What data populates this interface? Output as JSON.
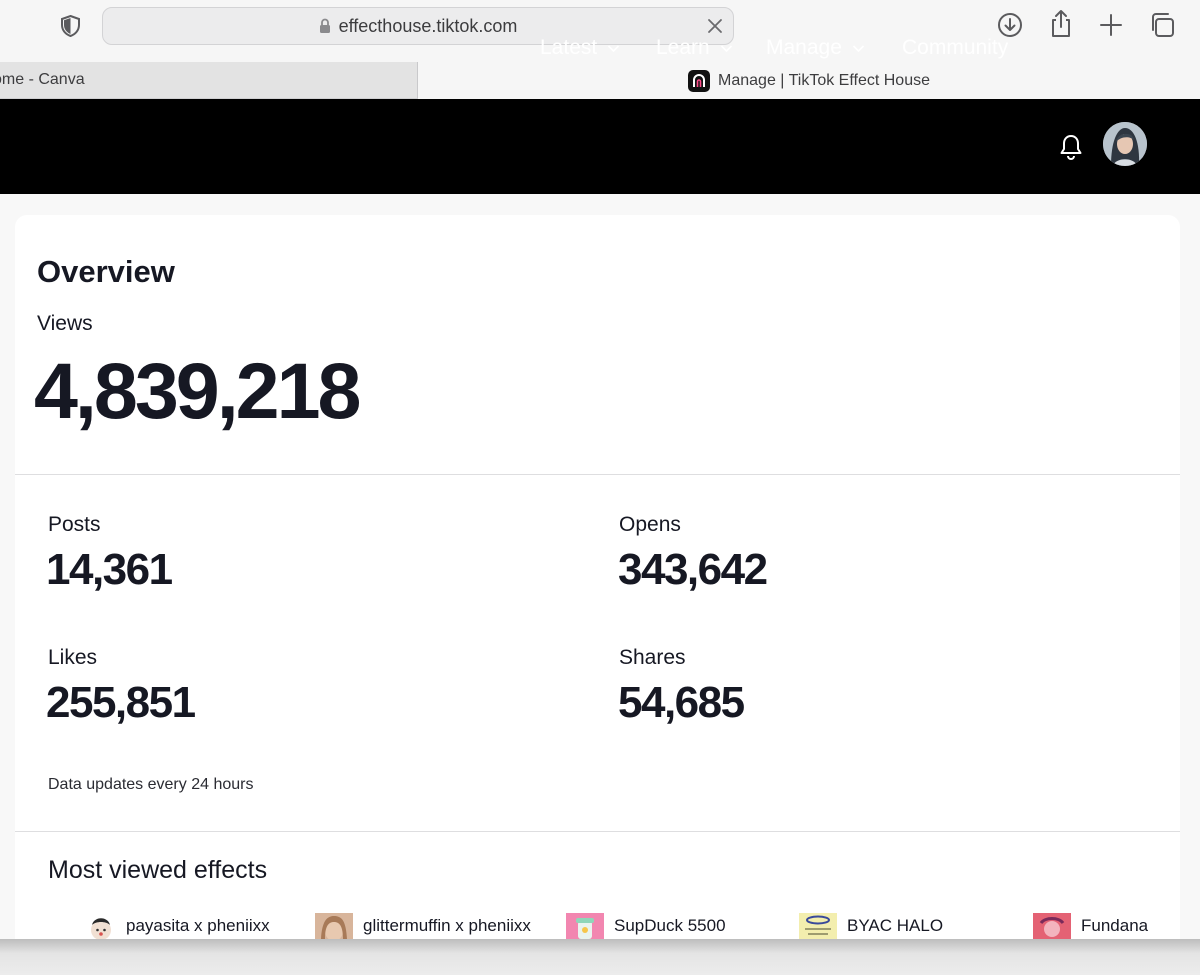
{
  "browser": {
    "url": "effecthouse.tiktok.com",
    "tabs": [
      {
        "title": "ome - Canva",
        "active": false
      },
      {
        "title": "Manage | TikTok Effect House",
        "active": true
      }
    ]
  },
  "nav": {
    "items": [
      {
        "label": "Latest",
        "has_dropdown": true
      },
      {
        "label": "Learn",
        "has_dropdown": true
      },
      {
        "label": "Manage",
        "has_dropdown": true
      },
      {
        "label": "Community",
        "has_dropdown": false
      }
    ],
    "icons": [
      "bell-icon",
      "avatar"
    ]
  },
  "overview": {
    "title": "Overview",
    "views_label": "Views",
    "views_value": "4,839,218",
    "stats": {
      "posts": {
        "label": "Posts",
        "value": "14,361"
      },
      "opens": {
        "label": "Opens",
        "value": "343,642"
      },
      "likes": {
        "label": "Likes",
        "value": "255,851"
      },
      "shares": {
        "label": "Shares",
        "value": "54,685"
      }
    },
    "update_note": "Data updates every 24 hours"
  },
  "most_viewed": {
    "title": "Most viewed effects",
    "effects": [
      {
        "name": "payasita x pheniixx",
        "thumb_color": "#e9d4c4"
      },
      {
        "name": "glittermuffin x pheniixx",
        "thumb_color": "#c9a58a"
      },
      {
        "name": "SupDuck 5500",
        "thumb_color": "#f07aa8"
      },
      {
        "name": "BYAC HALO",
        "thumb_color": "#f4efb2"
      },
      {
        "name": "Fundana",
        "thumb_color": "#e05a6a"
      }
    ]
  },
  "colors": {
    "nav_bg": "#000000",
    "text_primary": "#161823",
    "page_bg": "#f8f8f8"
  }
}
